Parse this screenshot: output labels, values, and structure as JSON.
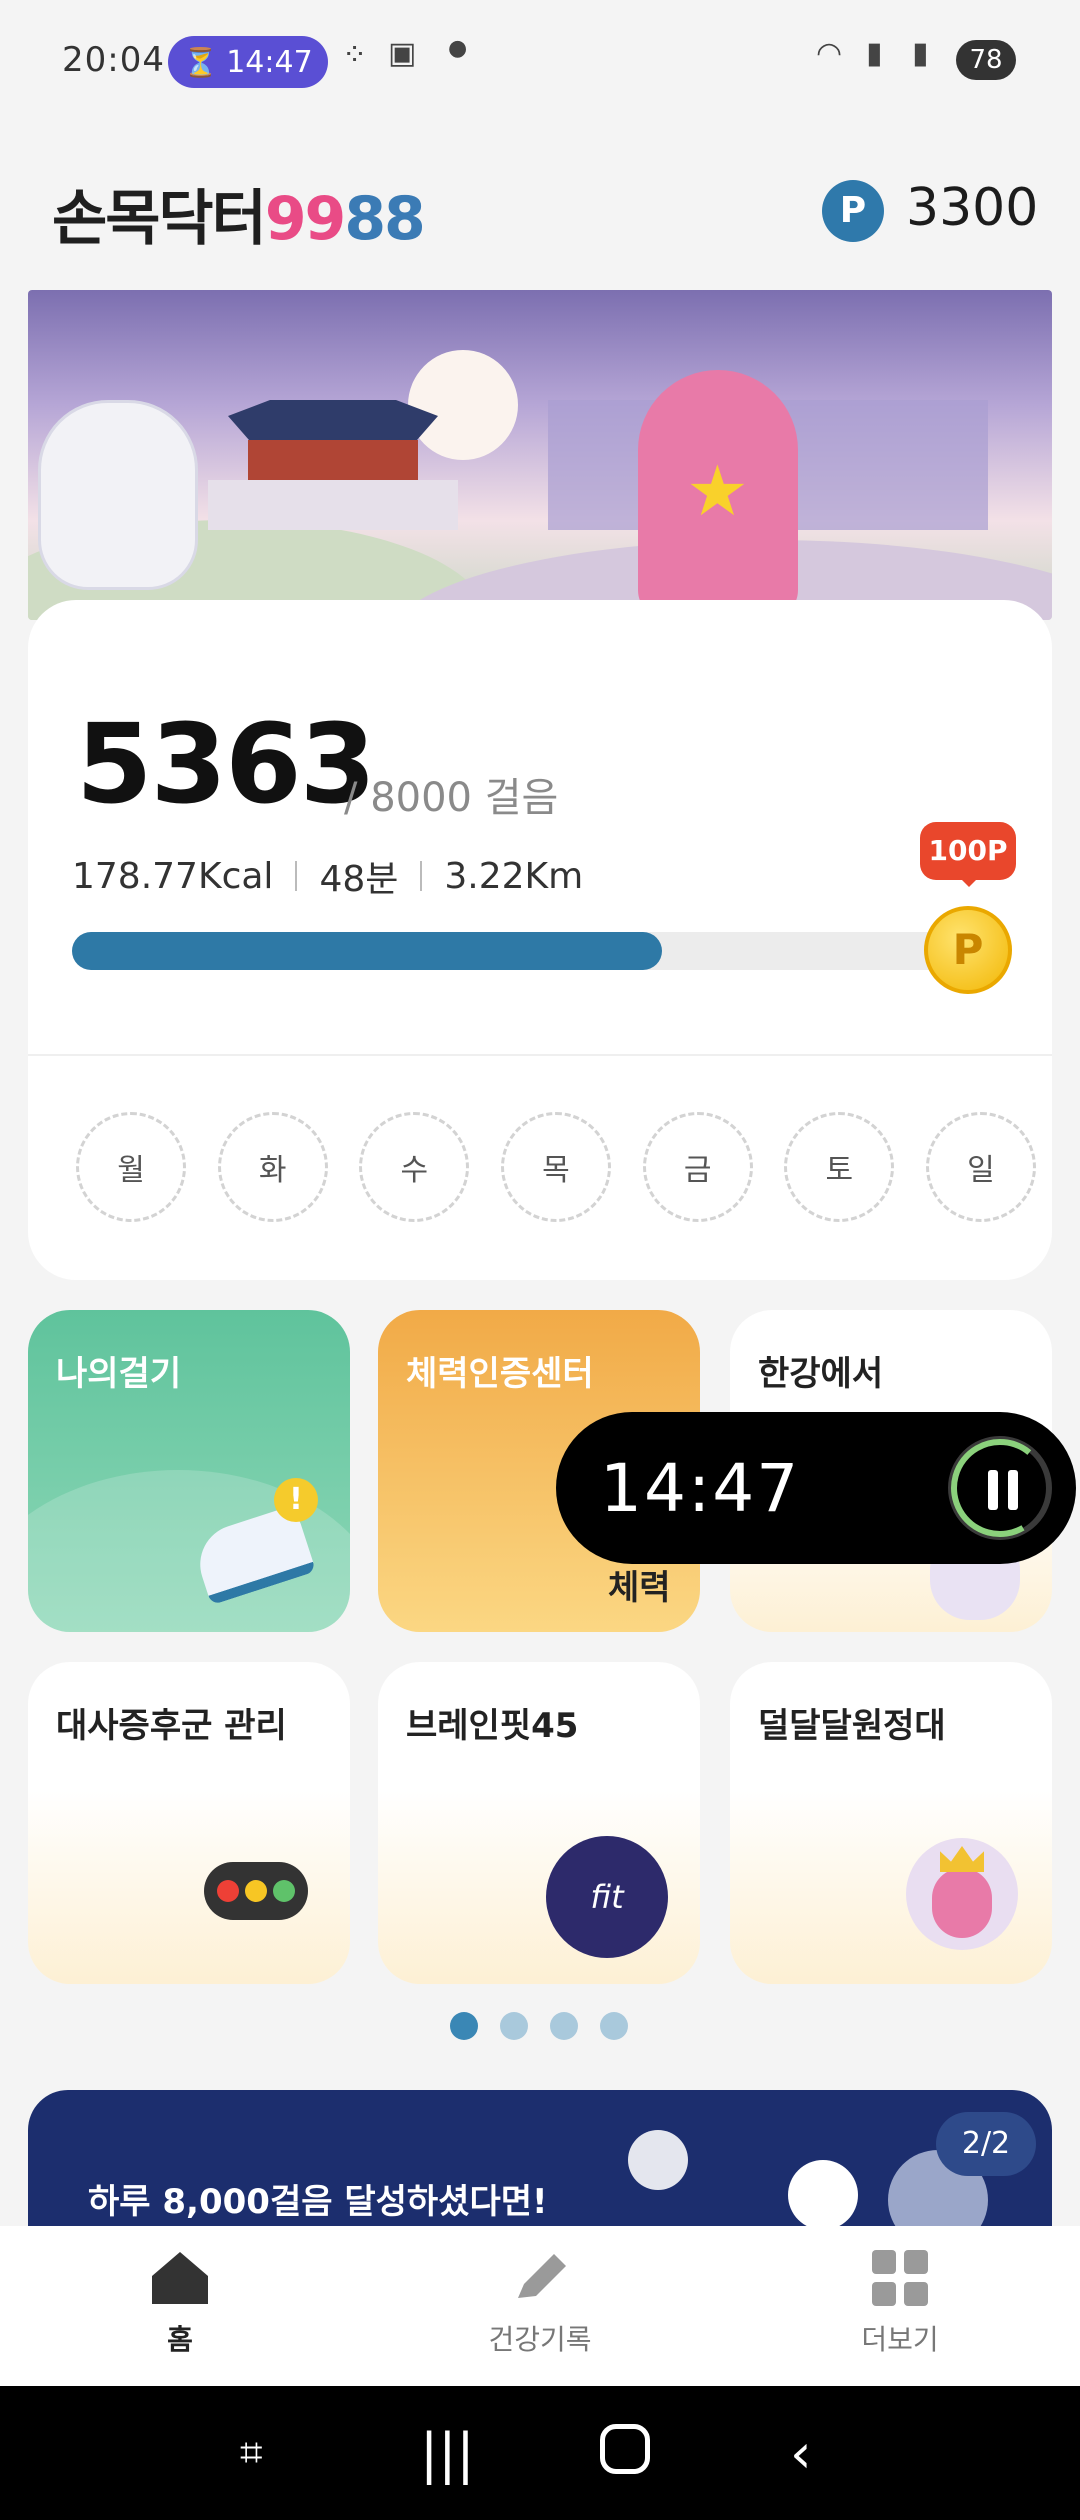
{
  "status_bar": {
    "time": "20:04",
    "timer": "14:47",
    "battery": "78"
  },
  "header": {
    "logo_main": "손목닥터",
    "logo_99": "99",
    "logo_88": "88",
    "points_icon": "P",
    "points": "3300"
  },
  "steps": {
    "count": "5363",
    "goal": "/ 8000 걸음",
    "kcal": "178.77Kcal",
    "minutes": "48분",
    "distance": "3.22Km",
    "progress_fraction": 0.67,
    "reward_tag": "100P",
    "reward_coin": "P",
    "weekdays": [
      "월",
      "화",
      "수",
      "목",
      "금",
      "토",
      "일"
    ]
  },
  "tiles": {
    "walk": "나의걸기",
    "fitness": "체력인증센터",
    "fitness_sub": "체력",
    "hangang": "한강에서",
    "metabolic": "대사증후군 관리",
    "brainfit": "브레인핏45",
    "brainfit_logo": "fit",
    "moon": "덜달달원정대"
  },
  "floating_timer": {
    "time": "14:47"
  },
  "page_dots": {
    "count": 4,
    "active": 0
  },
  "promo": {
    "text": "하루 8,000걸음 달성하셨다면!",
    "page": "2/2"
  },
  "bottom_nav": {
    "home": "홈",
    "health_record": "건강기록",
    "more": "더보기"
  },
  "colors": {
    "primary": "#2e79a6",
    "accent_pink": "#e94b86",
    "walk_tile": "#5fc39c",
    "fitness_tile": "#f1aa47",
    "reward": "#e9472c"
  },
  "icons": [
    "hourglass-icon",
    "wifi-icon",
    "signal-icon",
    "home-icon",
    "pencil-icon",
    "grid-icon",
    "shoe-icon",
    "traffic-light-icon",
    "pause-icon"
  ]
}
